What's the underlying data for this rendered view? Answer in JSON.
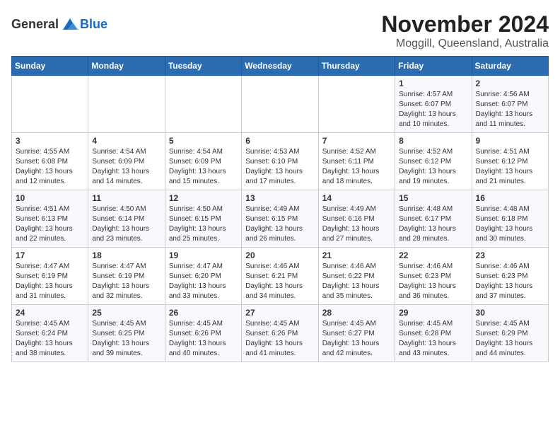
{
  "header": {
    "logo_general": "General",
    "logo_blue": "Blue",
    "month_year": "November 2024",
    "location": "Moggill, Queensland, Australia"
  },
  "weekdays": [
    "Sunday",
    "Monday",
    "Tuesday",
    "Wednesday",
    "Thursday",
    "Friday",
    "Saturday"
  ],
  "weeks": [
    [
      {
        "day": "",
        "info": ""
      },
      {
        "day": "",
        "info": ""
      },
      {
        "day": "",
        "info": ""
      },
      {
        "day": "",
        "info": ""
      },
      {
        "day": "",
        "info": ""
      },
      {
        "day": "1",
        "info": "Sunrise: 4:57 AM\nSunset: 6:07 PM\nDaylight: 13 hours\nand 10 minutes."
      },
      {
        "day": "2",
        "info": "Sunrise: 4:56 AM\nSunset: 6:07 PM\nDaylight: 13 hours\nand 11 minutes."
      }
    ],
    [
      {
        "day": "3",
        "info": "Sunrise: 4:55 AM\nSunset: 6:08 PM\nDaylight: 13 hours\nand 12 minutes."
      },
      {
        "day": "4",
        "info": "Sunrise: 4:54 AM\nSunset: 6:09 PM\nDaylight: 13 hours\nand 14 minutes."
      },
      {
        "day": "5",
        "info": "Sunrise: 4:54 AM\nSunset: 6:09 PM\nDaylight: 13 hours\nand 15 minutes."
      },
      {
        "day": "6",
        "info": "Sunrise: 4:53 AM\nSunset: 6:10 PM\nDaylight: 13 hours\nand 17 minutes."
      },
      {
        "day": "7",
        "info": "Sunrise: 4:52 AM\nSunset: 6:11 PM\nDaylight: 13 hours\nand 18 minutes."
      },
      {
        "day": "8",
        "info": "Sunrise: 4:52 AM\nSunset: 6:12 PM\nDaylight: 13 hours\nand 19 minutes."
      },
      {
        "day": "9",
        "info": "Sunrise: 4:51 AM\nSunset: 6:12 PM\nDaylight: 13 hours\nand 21 minutes."
      }
    ],
    [
      {
        "day": "10",
        "info": "Sunrise: 4:51 AM\nSunset: 6:13 PM\nDaylight: 13 hours\nand 22 minutes."
      },
      {
        "day": "11",
        "info": "Sunrise: 4:50 AM\nSunset: 6:14 PM\nDaylight: 13 hours\nand 23 minutes."
      },
      {
        "day": "12",
        "info": "Sunrise: 4:50 AM\nSunset: 6:15 PM\nDaylight: 13 hours\nand 25 minutes."
      },
      {
        "day": "13",
        "info": "Sunrise: 4:49 AM\nSunset: 6:15 PM\nDaylight: 13 hours\nand 26 minutes."
      },
      {
        "day": "14",
        "info": "Sunrise: 4:49 AM\nSunset: 6:16 PM\nDaylight: 13 hours\nand 27 minutes."
      },
      {
        "day": "15",
        "info": "Sunrise: 4:48 AM\nSunset: 6:17 PM\nDaylight: 13 hours\nand 28 minutes."
      },
      {
        "day": "16",
        "info": "Sunrise: 4:48 AM\nSunset: 6:18 PM\nDaylight: 13 hours\nand 30 minutes."
      }
    ],
    [
      {
        "day": "17",
        "info": "Sunrise: 4:47 AM\nSunset: 6:19 PM\nDaylight: 13 hours\nand 31 minutes."
      },
      {
        "day": "18",
        "info": "Sunrise: 4:47 AM\nSunset: 6:19 PM\nDaylight: 13 hours\nand 32 minutes."
      },
      {
        "day": "19",
        "info": "Sunrise: 4:47 AM\nSunset: 6:20 PM\nDaylight: 13 hours\nand 33 minutes."
      },
      {
        "day": "20",
        "info": "Sunrise: 4:46 AM\nSunset: 6:21 PM\nDaylight: 13 hours\nand 34 minutes."
      },
      {
        "day": "21",
        "info": "Sunrise: 4:46 AM\nSunset: 6:22 PM\nDaylight: 13 hours\nand 35 minutes."
      },
      {
        "day": "22",
        "info": "Sunrise: 4:46 AM\nSunset: 6:23 PM\nDaylight: 13 hours\nand 36 minutes."
      },
      {
        "day": "23",
        "info": "Sunrise: 4:46 AM\nSunset: 6:23 PM\nDaylight: 13 hours\nand 37 minutes."
      }
    ],
    [
      {
        "day": "24",
        "info": "Sunrise: 4:45 AM\nSunset: 6:24 PM\nDaylight: 13 hours\nand 38 minutes."
      },
      {
        "day": "25",
        "info": "Sunrise: 4:45 AM\nSunset: 6:25 PM\nDaylight: 13 hours\nand 39 minutes."
      },
      {
        "day": "26",
        "info": "Sunrise: 4:45 AM\nSunset: 6:26 PM\nDaylight: 13 hours\nand 40 minutes."
      },
      {
        "day": "27",
        "info": "Sunrise: 4:45 AM\nSunset: 6:26 PM\nDaylight: 13 hours\nand 41 minutes."
      },
      {
        "day": "28",
        "info": "Sunrise: 4:45 AM\nSunset: 6:27 PM\nDaylight: 13 hours\nand 42 minutes."
      },
      {
        "day": "29",
        "info": "Sunrise: 4:45 AM\nSunset: 6:28 PM\nDaylight: 13 hours\nand 43 minutes."
      },
      {
        "day": "30",
        "info": "Sunrise: 4:45 AM\nSunset: 6:29 PM\nDaylight: 13 hours\nand 44 minutes."
      }
    ]
  ]
}
